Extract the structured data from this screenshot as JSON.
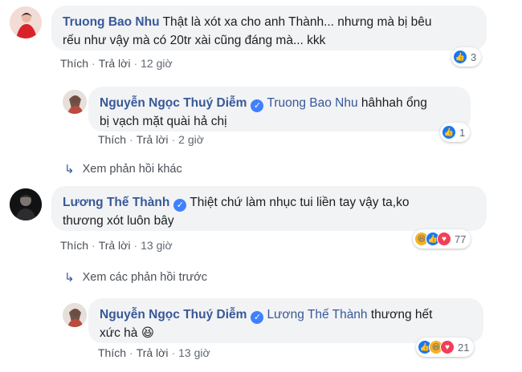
{
  "comments": [
    {
      "author": "Truong Bao Nhu",
      "text_line1": "Thật là xót xa cho anh Thành... nhưng mà bị bêu",
      "text_line2": "rếu như vậy mà có 20tr xài cũng đáng mà... kkk",
      "like": "Thích",
      "reply": "Trả lời",
      "time": "12 giờ",
      "reaction_count": "3"
    },
    {
      "author": "Nguyễn Ngọc Thuý Diễm",
      "mention": "Truong Bao Nhu",
      "text_line1": "hâhhah ổng",
      "text_line2": "bị vạch mặt quài hả chị",
      "like": "Thích",
      "reply": "Trả lời",
      "time": "2 giờ",
      "reaction_count": "1"
    },
    {
      "author": "Lương Thế Thành",
      "text_line1": "Thiệt chứ làm nhục tui liền tay vậy ta,ko",
      "text_line2": "thương xót luôn bây",
      "like": "Thích",
      "reply": "Trả lời",
      "time": "13 giờ",
      "reaction_count": "77"
    },
    {
      "author": "Nguyễn Ngọc Thuý Diễm",
      "mention": "Lương Thế Thành",
      "text_line1": "thương hết",
      "text_line2": "xức hà",
      "emoji": "😆",
      "like": "Thích",
      "reply": "Trả lời",
      "time": "13 giờ",
      "reaction_count": "21"
    }
  ],
  "links": {
    "more_replies": "Xem phản hồi khác",
    "previous_replies": "Xem các phản hồi trước"
  },
  "icons": {
    "verified": "✓",
    "reply_arrow": "↳",
    "like": "👍",
    "haha": "😆",
    "love": "♥"
  },
  "colors": {
    "link": "#385898",
    "bubble": "#f2f3f5",
    "like_blue": "#1877f2",
    "love_red": "#f33e58"
  }
}
